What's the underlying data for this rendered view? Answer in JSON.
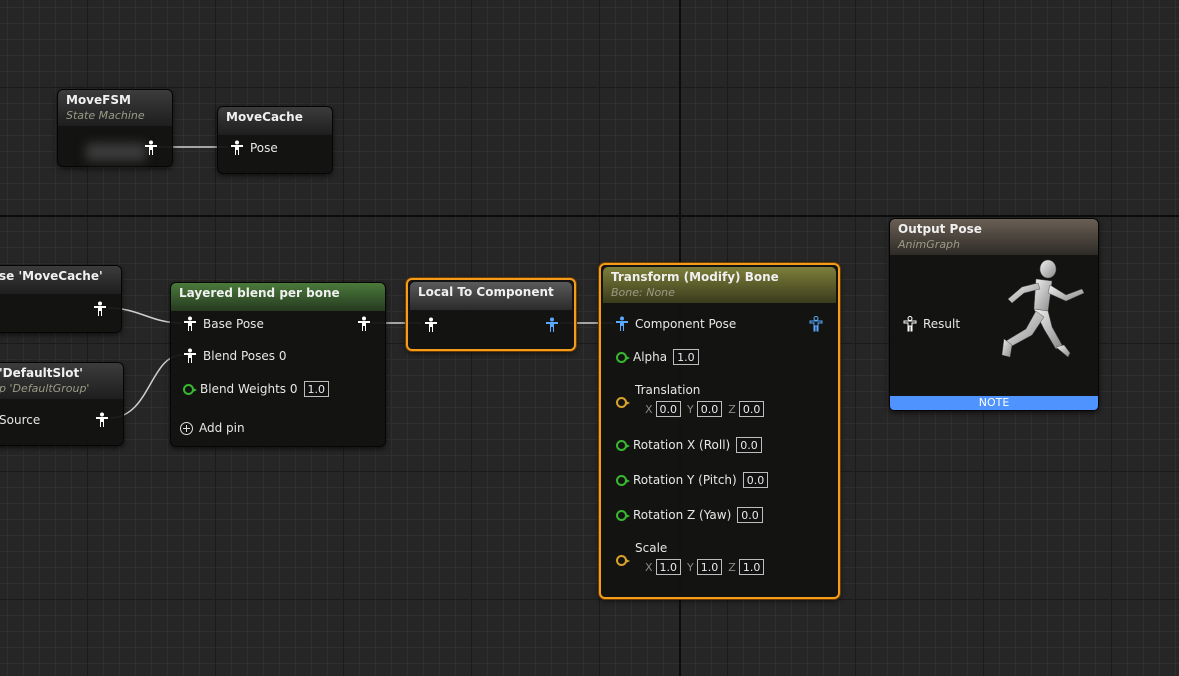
{
  "nodes": {
    "move_fsm": {
      "title": "MoveFSM",
      "subtitle": "State Machine"
    },
    "move_cache": {
      "title": "MoveCache",
      "pose_label": "Pose"
    },
    "use_cache": {
      "title": "se 'MoveCache'"
    },
    "slot": {
      "title": "'DefaultSlot'",
      "subtitle": "p 'DefaultGroup'",
      "source_label": "Source"
    },
    "layered_blend": {
      "title": "Layered blend per bone",
      "base_pose_label": "Base Pose",
      "blend_poses_label": "Blend Poses 0",
      "blend_weights_label": "Blend Weights 0",
      "blend_weights_value": "1.0",
      "add_pin_label": "Add pin"
    },
    "local_to_component": {
      "title": "Local To Component"
    },
    "transform_bone": {
      "title": "Transform (Modify) Bone",
      "subtitle": "Bone: None",
      "component_pose_label": "Component Pose",
      "alpha_label": "Alpha",
      "alpha_value": "1.0",
      "translation_label": "Translation",
      "translation": {
        "x": "0.0",
        "y": "0.0",
        "z": "0.0"
      },
      "rot_x_label": "Rotation X (Roll)",
      "rot_x_value": "0.0",
      "rot_y_label": "Rotation Y (Pitch)",
      "rot_y_value": "0.0",
      "rot_z_label": "Rotation Z (Yaw)",
      "rot_z_value": "0.0",
      "scale_label": "Scale",
      "scale": {
        "x": "1.0",
        "y": "1.0",
        "z": "1.0"
      },
      "axis_labels": {
        "x": "X",
        "y": "Y",
        "z": "Z"
      }
    },
    "output_pose": {
      "title": "Output Pose",
      "subtitle": "AnimGraph",
      "result_label": "Result",
      "note_label": "NOTE"
    }
  },
  "colors": {
    "selection": "#f59c1a",
    "exec_pin_green": "#37b82f",
    "vector_pin_yellow": "#d9a22a",
    "component_pose_blue": "#5aa8ff",
    "note_blue": "#4f93ff"
  },
  "icons": {
    "pose": "pose-pin-icon",
    "component_pose": "component-pose-pin-icon",
    "add": "add-pin-icon",
    "mannequin": "running-mannequin-icon"
  }
}
